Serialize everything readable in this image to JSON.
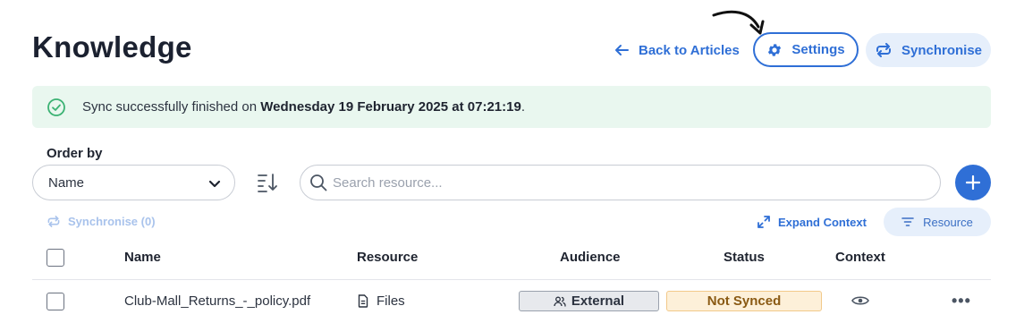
{
  "header": {
    "title": "Knowledge",
    "back_label": "Back to Articles",
    "settings_label": "Settings",
    "synchronise_label": "Synchronise"
  },
  "banner": {
    "prefix": "Sync successfully finished on ",
    "date": "Wednesday 19 February 2025 at 07:21:19",
    "suffix": "."
  },
  "toolbar": {
    "order_by_label": "Order by",
    "order_by_value": "Name",
    "search_placeholder": "Search resource...",
    "synchronise_count_label": "Synchronise (0)",
    "expand_context_label": "Expand Context",
    "resource_filter_label": "Resource"
  },
  "table": {
    "columns": [
      "Name",
      "Resource",
      "Audience",
      "Status",
      "Context"
    ],
    "rows": [
      {
        "name": "Club-Mall_Returns_-_policy.pdf",
        "resource": "Files",
        "audience": "External",
        "status": "Not Synced",
        "actions": "•••"
      }
    ]
  },
  "colors": {
    "accent": "#2f6fd6",
    "success_bg": "#e9f7ef",
    "success_icon": "#3bb273",
    "warning_bg": "#fdf0d9",
    "warning_text": "#8a5a14"
  }
}
